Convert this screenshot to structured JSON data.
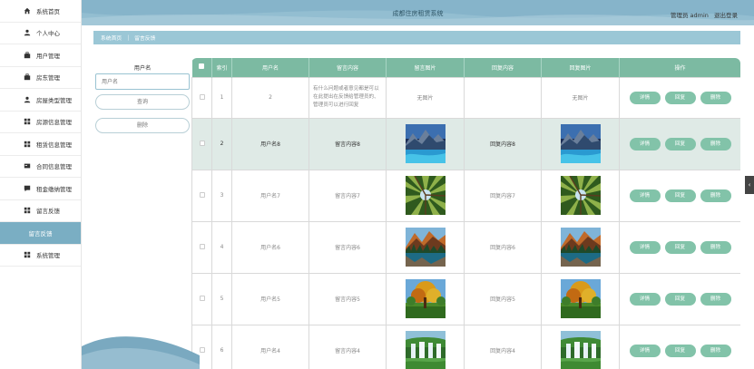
{
  "app": {
    "title": "成都住房租赁系统",
    "user_label": "管理员 admin",
    "logout": "退出登录"
  },
  "sidebar": {
    "items": [
      {
        "label": "系统首页",
        "icon": "home-icon"
      },
      {
        "label": "个人中心",
        "icon": "user-icon"
      },
      {
        "label": "用户管理",
        "icon": "briefcase-icon"
      },
      {
        "label": "房东管理",
        "icon": "briefcase-icon"
      },
      {
        "label": "房屋类型管理",
        "icon": "user-icon"
      },
      {
        "label": "房源信息管理",
        "icon": "grid-icon"
      },
      {
        "label": "租赁信息管理",
        "icon": "grid-icon"
      },
      {
        "label": "合同信息管理",
        "icon": "card-icon"
      },
      {
        "label": "租金缴纳管理",
        "icon": "comment-icon"
      },
      {
        "label": "留言反馈",
        "icon": "grid-icon"
      },
      {
        "label": "留言反馈",
        "icon": "",
        "sub": true
      },
      {
        "label": "系统管理",
        "icon": "grid-icon"
      }
    ]
  },
  "breadcrumb": {
    "home": "系统首页",
    "current": "留言反馈"
  },
  "search": {
    "label": "用户名",
    "placeholder": "用户名",
    "search_button": "查询",
    "delete_button": "删除"
  },
  "table": {
    "headers": [
      "",
      "索引",
      "用户名",
      "留言内容",
      "留言图片",
      "回复内容",
      "回复图片",
      "操作"
    ],
    "actions": {
      "detail": "详情",
      "reply": "回复",
      "delete": "删除"
    },
    "rows": [
      {
        "index": "1",
        "username": "2",
        "content": "有什么问题或者意见都是可以在此提出在反馈给管理员的、管理员可以进行回复",
        "image": "无图片",
        "reply": "",
        "reply_image": "无图片",
        "highlight": false
      },
      {
        "index": "2",
        "username": "用户名8",
        "content": "留言内容8",
        "image": "img-mountain-lake",
        "reply": "回复内容8",
        "reply_image": "img-mountain-lake",
        "highlight": true
      },
      {
        "index": "3",
        "username": "用户名7",
        "content": "留言内容7",
        "image": "img-forest",
        "reply": "回复内容7",
        "reply_image": "img-forest",
        "highlight": false
      },
      {
        "index": "4",
        "username": "用户名6",
        "content": "留言内容6",
        "image": "img-alpine",
        "reply": "回复内容6",
        "reply_image": "img-alpine",
        "highlight": false
      },
      {
        "index": "5",
        "username": "用户名5",
        "content": "留言内容5",
        "image": "img-autumn-tree",
        "reply": "回复内容5",
        "reply_image": "img-autumn-tree",
        "highlight": false
      },
      {
        "index": "6",
        "username": "用户名4",
        "content": "留言内容4",
        "image": "img-waterfall",
        "reply": "回复内容4",
        "reply_image": "img-waterfall",
        "highlight": false
      }
    ]
  },
  "colors": {
    "header": "#82b1c8",
    "accent": "#7cbaa2",
    "button": "#82c3a9",
    "breadcrumb": "#9bc7d6",
    "sidebar_active": "#7aaec3"
  }
}
